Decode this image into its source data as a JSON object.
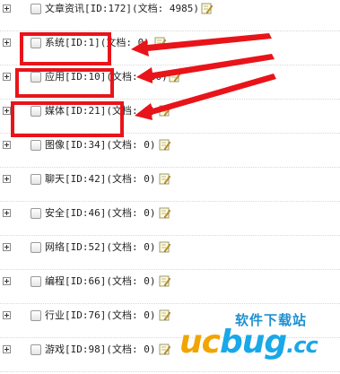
{
  "category_tree": {
    "rows": [
      {
        "label": "文章资讯[ID:172](文档: 4985)"
      },
      {
        "label": "系统[ID:1](文档: 0)"
      },
      {
        "label": "应用[ID:10](文档: 780)"
      },
      {
        "label": "媒体[ID:21](文档: 0)"
      },
      {
        "label": "图像[ID:34](文档: 0)"
      },
      {
        "label": "聊天[ID:42](文档: 0)"
      },
      {
        "label": "安全[ID:46](文档: 0)"
      },
      {
        "label": "网络[ID:52](文档: 0)"
      },
      {
        "label": "编程[ID:66](文档: 0)"
      },
      {
        "label": "行业[ID:76](文档: 0)"
      },
      {
        "label": "游戏[ID:98](文档: 0)"
      }
    ]
  },
  "annotation_color": "#e8141a",
  "watermark": {
    "site_name_cn": "软件下载站",
    "logo_uc": "uc",
    "logo_bug": "bug",
    "logo_cc": ".cc"
  },
  "icons": {
    "expander": "plus-box-icon",
    "edit": "pencil-page-icon"
  }
}
